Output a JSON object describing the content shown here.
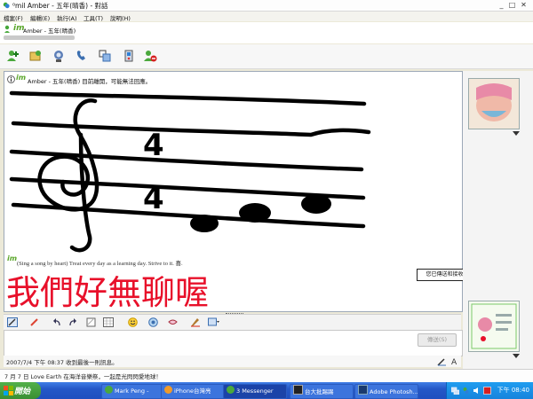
{
  "window": {
    "title": "⁰mil Amber - 五年(晴香) - 對話",
    "minimize_label": "_",
    "maximize_label": "□",
    "close_label": "✕"
  },
  "menu": {
    "items": [
      {
        "label": "檔案(F)"
      },
      {
        "label": "編輯(E)"
      },
      {
        "label": "執行(A)"
      },
      {
        "label": "工具(T)"
      },
      {
        "label": "說明(H)"
      }
    ]
  },
  "contact": {
    "name": "Amber - 五年(晴香)",
    "im_logo": "im"
  },
  "toolbar": {
    "icons": [
      "invite-contact-icon",
      "send-file-icon",
      "video-icon",
      "call-icon",
      "activities-icon",
      "games-icon",
      "block-icon"
    ]
  },
  "conversation": {
    "notice": "Amber - 五年(晴香) 目前離開，可能無法回應。",
    "message": "(Sing a song by heart) Treat every day as a learning day. Strive to it. 喜.",
    "handwriting_text": "我們好無聊喔",
    "time_signature_top": "4",
    "time_signature_bottom": "4"
  },
  "tooltip": {
    "text": "您已傳送和接收的訊息"
  },
  "compose": {
    "send_label": "傳送(S)",
    "status": "2007/7/4 下午 08:37 收到最後一則訊息。"
  },
  "news": {
    "text": "7 月 7 日 Love Earth 在海洋音樂祭，一起是光閃閃愛地球！"
  },
  "taskbar": {
    "start_label": "開始",
    "tasks": [
      {
        "label": "Mark Peng -",
        "active": false
      },
      {
        "label": "iPhone台灣亮",
        "active": false
      },
      {
        "label": "3 Messenger",
        "active": true
      },
      {
        "label": "台大批踢踢",
        "active": false
      },
      {
        "label": "Adobe Photosh...",
        "active": false
      }
    ],
    "clock": "下午 08:40"
  },
  "colors": {
    "im_green": "#5aa62a",
    "handwriting_red": "#e8102a",
    "taskbar_blue": "#2457c7"
  }
}
